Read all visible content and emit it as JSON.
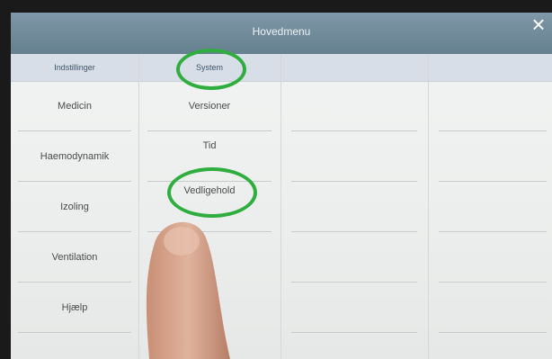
{
  "window": {
    "title": "Hovedmenu",
    "close_icon": "×"
  },
  "columns": {
    "col1_header": "Indstillinger",
    "col2_header": "System"
  },
  "menu_items": [
    "Medicin",
    "Haemodynamik",
    "Izoling",
    "Ventilation",
    "Hjælp"
  ],
  "system_items": [
    "Versioner",
    "Tid",
    "Vedligehold"
  ],
  "colors": {
    "titlebar": "#6f8a9b",
    "header_row": "#d7dee7",
    "highlight": "#2fae3f"
  }
}
